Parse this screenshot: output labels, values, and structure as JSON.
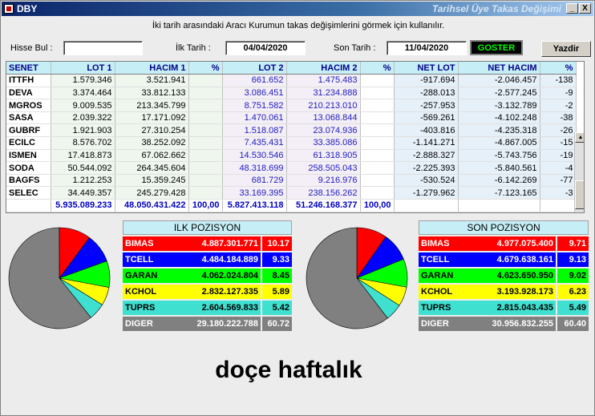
{
  "window": {
    "title": "DBY",
    "subtitle_right": "Tarihsel Üye Takas Değişimi",
    "min": "_",
    "max": "□",
    "close": "X"
  },
  "description": "İki tarih arasındaki  Aracı Kurumun takas değişimlerini görmek için kullanılır.",
  "controls": {
    "hisse_label": "Hisse Bul :",
    "hisse_value": "",
    "ilk_label": "İlk Tarih :",
    "ilk_value": "04/04/2020",
    "son_label": "Son Tarih :",
    "son_value": "11/04/2020",
    "goster": "GOSTER",
    "yazdir": "Yazdir"
  },
  "table": {
    "headers": [
      "SENET",
      "LOT 1",
      "HACIM 1",
      "%",
      "LOT 2",
      "HACIM 2",
      "%",
      "NET LOT",
      "NET HACIM",
      "%"
    ],
    "rows": [
      [
        "ITTFH",
        "1.579.346",
        "3.521.941",
        "",
        "661.652",
        "1.475.483",
        "",
        "-917.694",
        "-2.046.457",
        "-138"
      ],
      [
        "DEVA",
        "3.374.464",
        "33.812.133",
        "",
        "3.086.451",
        "31.234.888",
        "",
        "-288.013",
        "-2.577.245",
        "-9"
      ],
      [
        "MGROS",
        "9.009.535",
        "213.345.799",
        "",
        "8.751.582",
        "210.213.010",
        "",
        "-257.953",
        "-3.132.789",
        "-2"
      ],
      [
        "SASA",
        "2.039.322",
        "17.171.092",
        "",
        "1.470.061",
        "13.068.844",
        "",
        "-569.261",
        "-4.102.248",
        "-38"
      ],
      [
        "GUBRF",
        "1.921.903",
        "27.310.254",
        "",
        "1.518.087",
        "23.074.936",
        "",
        "-403.816",
        "-4.235.318",
        "-26"
      ],
      [
        "ECILC",
        "8.576.702",
        "38.252.092",
        "",
        "7.435.431",
        "33.385.086",
        "",
        "-1.141.271",
        "-4.867.005",
        "-15"
      ],
      [
        "ISMEN",
        "17.418.873",
        "67.062.662",
        "",
        "14.530.546",
        "61.318.905",
        "",
        "-2.888.327",
        "-5.743.756",
        "-19"
      ],
      [
        "SODA",
        "50.544.092",
        "264.345.604",
        "",
        "48.318.699",
        "258.505.043",
        "",
        "-2.225.393",
        "-5.840.561",
        "-4"
      ],
      [
        "BAGFS",
        "1.212.253",
        "15.359.245",
        "",
        "681.729",
        "9.216.976",
        "",
        "-530.524",
        "-6.142.269",
        "-77"
      ],
      [
        "SELEC",
        "34.449.357",
        "245.279.428",
        "",
        "33.169.395",
        "238.156.262",
        "",
        "-1.279.962",
        "-7.123.165",
        "-3"
      ]
    ],
    "totals": [
      "",
      "5.935.089.233",
      "48.050.431.422",
      "100,00",
      "5.827.413.118",
      "51.246.168.377",
      "100,00",
      "",
      "",
      ""
    ]
  },
  "ilk_pozisyon": {
    "title": "ILK POZISYON",
    "rows": [
      {
        "name": "BIMAS",
        "value": "4.887.301.771",
        "pct": "10.17",
        "bg": "#ff0000",
        "fg": "#ffffff"
      },
      {
        "name": "TCELL",
        "value": "4.484.184.889",
        "pct": "9.33",
        "bg": "#0000ff",
        "fg": "#ffffff"
      },
      {
        "name": "GARAN",
        "value": "4.062.024.804",
        "pct": "8.45",
        "bg": "#00ff00",
        "fg": "#000000"
      },
      {
        "name": "KCHOL",
        "value": "2.832.127.335",
        "pct": "5.89",
        "bg": "#ffff00",
        "fg": "#000000"
      },
      {
        "name": "TUPRS",
        "value": "2.604.569.833",
        "pct": "5.42",
        "bg": "#40e0d0",
        "fg": "#000000"
      },
      {
        "name": "DIGER",
        "value": "29.180.222.788",
        "pct": "60.72",
        "bg": "#808080",
        "fg": "#ffffff"
      }
    ]
  },
  "son_pozisyon": {
    "title": "SON POZISYON",
    "rows": [
      {
        "name": "BIMAS",
        "value": "4.977.075.400",
        "pct": "9.71",
        "bg": "#ff0000",
        "fg": "#ffffff"
      },
      {
        "name": "TCELL",
        "value": "4.679.638.161",
        "pct": "9.13",
        "bg": "#0000ff",
        "fg": "#ffffff"
      },
      {
        "name": "GARAN",
        "value": "4.623.650.950",
        "pct": "9.02",
        "bg": "#00ff00",
        "fg": "#000000"
      },
      {
        "name": "KCHOL",
        "value": "3.193.928.173",
        "pct": "6.23",
        "bg": "#ffff00",
        "fg": "#000000"
      },
      {
        "name": "TUPRS",
        "value": "2.815.043.435",
        "pct": "5.49",
        "bg": "#40e0d0",
        "fg": "#000000"
      },
      {
        "name": "DIGER",
        "value": "30.956.832.255",
        "pct": "60.40",
        "bg": "#808080",
        "fg": "#ffffff"
      }
    ]
  },
  "caption": "doçe haftalık"
}
